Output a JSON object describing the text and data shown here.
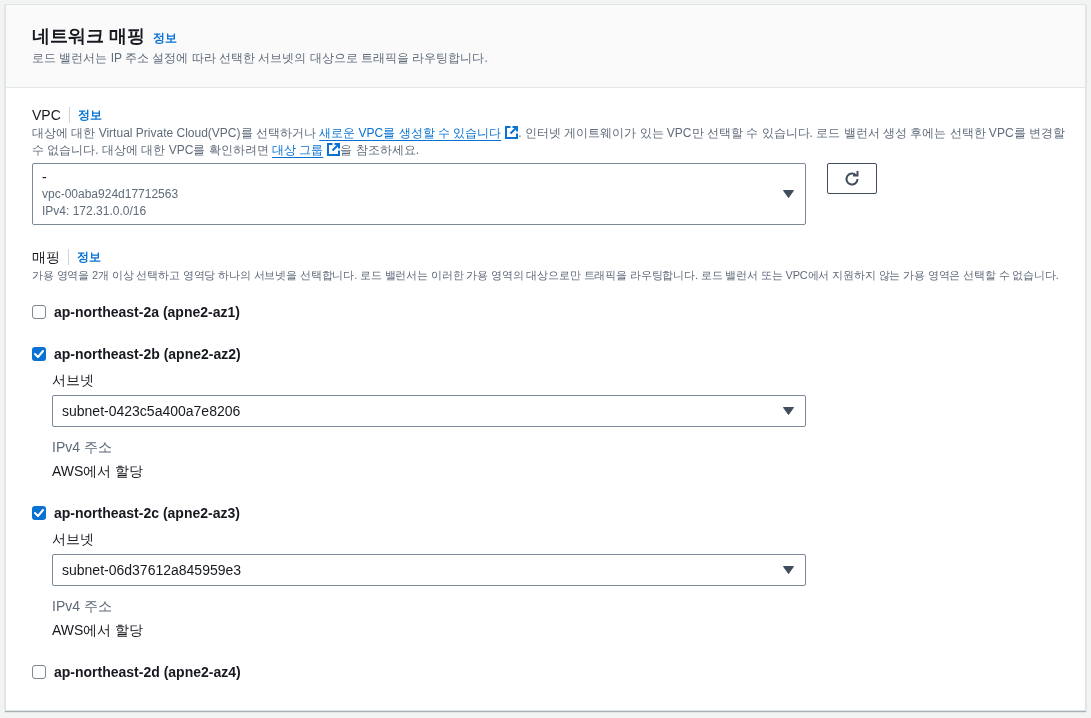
{
  "section": {
    "title": "네트워크 매핑",
    "info_link": "정보",
    "description": "로드 밸런서는 IP 주소 설정에 따라 선택한 서브넷의 대상으로 트래픽을 라우팅합니다."
  },
  "vpc": {
    "label": "VPC",
    "info_link": "정보",
    "description": [
      {
        "kind": "text",
        "text": "대상에 대한 Virtual Private Cloud(VPC)를 선택하거나 "
      },
      {
        "kind": "link",
        "text": "새로운 VPC를 생성할 수 있습니다"
      },
      {
        "kind": "text",
        "text": ". 인터넷 게이트웨이가 있는 VPC만 선택할 수 있습니다. 로드 밸런서 생성 후에는 선택한 VPC를 변경할 수 없습니다. 대상에 대한 VPC를 확인하려면 "
      },
      {
        "kind": "link",
        "text": "대상 그룹"
      },
      {
        "kind": "text",
        "text": "을 참조하세요."
      }
    ],
    "select": {
      "value": "-",
      "vpc_id": "vpc-00aba924d17712563",
      "cidr": "IPv4: 172.31.0.0/16"
    }
  },
  "mappings": {
    "label": "매핑",
    "info_link": "정보",
    "description": "가용 영역을 2개 이상 선택하고 영역당 하나의 서브넷을 선택합니다. 로드 밸런서는 이러한 가용 영역의 대상으로만 트래픽을 라우팅합니다. 로드 밸런서 또는 VPC에서 지원하지 않는 가용 영역은 선택할 수 없습니다.",
    "zones": [
      {
        "label": "ap-northeast-2a (apne2-az1)",
        "checked": false
      },
      {
        "label": "ap-northeast-2b (apne2-az2)",
        "checked": true,
        "subnet_label": "서브넷",
        "subnet": "subnet-0423c5a400a7e8206",
        "ipv4_label": "IPv4 주소",
        "ipv4_value": "AWS에서 할당"
      },
      {
        "label": "ap-northeast-2c (apne2-az3)",
        "checked": true,
        "subnet_label": "서브넷",
        "subnet": "subnet-06d37612a845959e3",
        "ipv4_label": "IPv4 주소",
        "ipv4_value": "AWS에서 할당"
      },
      {
        "label": "ap-northeast-2d (apne2-az4)",
        "checked": false
      }
    ]
  }
}
